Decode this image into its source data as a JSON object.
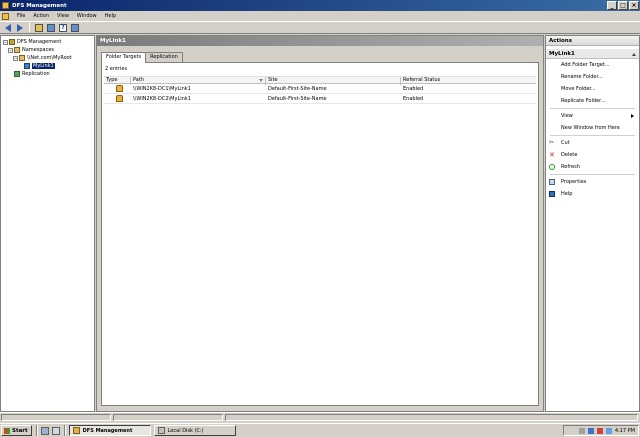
{
  "window": {
    "title": "DFS Management",
    "controls": [
      "_",
      "□",
      "×"
    ]
  },
  "menu": [
    "File",
    "Action",
    "View",
    "Window",
    "Help"
  ],
  "toolbar": {
    "icons": [
      "back-arrow-icon",
      "forward-arrow-icon",
      "up-folder-icon",
      "show-hide-tree-icon",
      "help-icon",
      "properties-icon"
    ]
  },
  "tree": {
    "root": "DFS Management",
    "namespaces": "Namespaces",
    "namespace_path": "\\\\Net.com\\MyRoot",
    "folder": "MyLink1",
    "replication": "Replication",
    "expander_root": "−",
    "expander_ns": "−",
    "expander_path": "−"
  },
  "center": {
    "header": "MyLink1",
    "tabs": [
      "Folder Targets",
      "Replication"
    ],
    "entries": "2 entries",
    "columns": [
      "Type",
      "Path",
      "Site",
      "Referral Status"
    ],
    "rows": [
      {
        "path": "\\\\WIN2K8-DC1\\MyLink1",
        "site": "Default-First-Site-Name",
        "status": "Enabled"
      },
      {
        "path": "\\\\WIN2K8-DC2\\MyLink1",
        "site": "Default-First-Site-Name",
        "status": "Enabled"
      }
    ]
  },
  "actions": {
    "header": "Actions",
    "section": "MyLink1",
    "group1": [
      "Add Folder Target...",
      "Rename Folder...",
      "Move Folder...",
      "Replicate Folder..."
    ],
    "view": "View",
    "new_window": "New Window from Here",
    "cut": "Cut",
    "delete": "Delete",
    "refresh": "Refresh",
    "properties": "Properties",
    "help": "Help"
  },
  "taskbar": {
    "start": "Start",
    "tasks": [
      "DFS Management",
      "Local Disk (C:)"
    ],
    "clock": "4:17 PM"
  },
  "colors": {
    "title_bar": "#0a246a",
    "selection": "#0a246a",
    "chrome": "#d4d0c8"
  }
}
